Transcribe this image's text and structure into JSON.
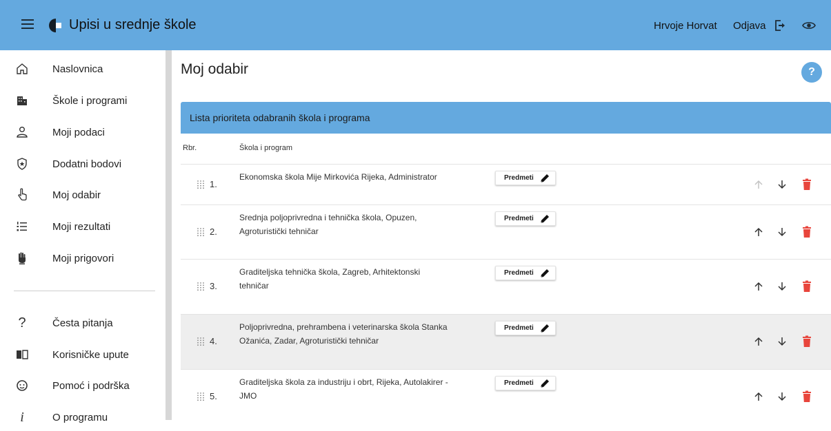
{
  "header": {
    "title": "Upisi u srednje škole",
    "user": "Hrvoje Horvat",
    "logout": "Odjava"
  },
  "sidebar": {
    "items": [
      {
        "label": "Naslovnica",
        "icon": "home-icon"
      },
      {
        "label": "Škole i programi",
        "icon": "building-icon"
      },
      {
        "label": "Moji podaci",
        "icon": "person-icon"
      },
      {
        "label": "Dodatni bodovi",
        "icon": "badge-star-icon"
      },
      {
        "label": "Moj odabir",
        "icon": "hand-pointer-icon"
      },
      {
        "label": "Moji rezultati",
        "icon": "list-numbered-icon"
      },
      {
        "label": "Moji prigovori",
        "icon": "raised-hand-icon"
      }
    ],
    "secondary": [
      {
        "label": "Česta pitanja",
        "icon": "question-icon"
      },
      {
        "label": "Korisničke upute",
        "icon": "book-icon"
      },
      {
        "label": "Pomoć i podrška",
        "icon": "support-icon"
      },
      {
        "label": "O programu",
        "icon": "info-icon"
      }
    ]
  },
  "main": {
    "page_title": "Moj odabir",
    "help": "?",
    "card_title": "Lista prioriteta odabranih škola i programa",
    "col_rbr": "Rbr.",
    "col_school": "Škola i program",
    "predmeti_label": "Predmeti",
    "rows": [
      {
        "num": "1.",
        "line1": "Ekonomska škola Mije Mirkovića Rijeka, Administrator",
        "line2": ""
      },
      {
        "num": "2.",
        "line1": "Srednja poljoprivredna i tehnička škola, Opuzen,",
        "line2": "Agroturistički tehničar"
      },
      {
        "num": "3.",
        "line1": "Graditeljska tehnička škola, Zagreb, Arhitektonski",
        "line2": "tehničar"
      },
      {
        "num": "4.",
        "line1": "Poljoprivredna, prehrambena i veterinarska škola Stanka",
        "line2": "Ožanića, Zadar, Agroturistički tehničar"
      },
      {
        "num": "5.",
        "line1": "Graditeljska škola za industriju i obrt, Rijeka, Autolakirer -",
        "line2": "JMO"
      }
    ]
  },
  "colors": {
    "accent": "#64a9df",
    "delete": "#e8453c",
    "row_highlight": "#eeeeee"
  }
}
